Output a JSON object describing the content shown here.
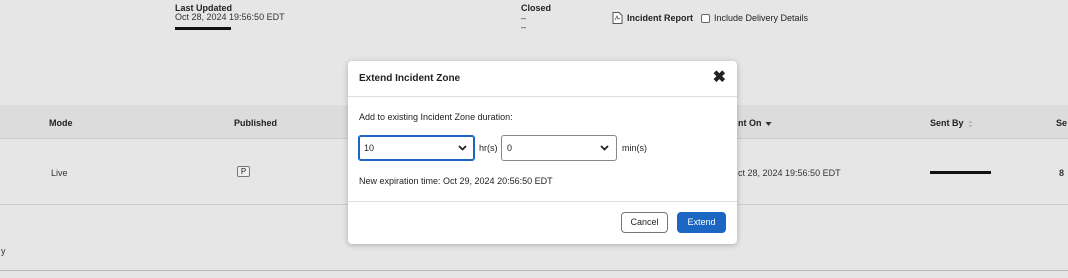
{
  "info": {
    "last_updated_label": "Last Updated",
    "last_updated_value": "Oct 28, 2024 19:56:50 EDT",
    "closed_label": "Closed",
    "closed_value1": "–",
    "closed_value2": "–"
  },
  "report": {
    "label": "Incident Report",
    "include_label": "Include Delivery Details"
  },
  "table": {
    "headers": {
      "mode": "Mode",
      "published": "Published",
      "sent_on": "nt On",
      "sent_by": "Sent By",
      "se": "Se"
    },
    "row": {
      "mode": "Live",
      "published_badge": "P",
      "sent_on": "ct 28, 2024 19:56:50 EDT",
      "se": "8"
    },
    "footer_partial": "y"
  },
  "modal": {
    "title": "Extend Incident Zone",
    "prompt": "Add to existing Incident Zone duration:",
    "hours_value": "10",
    "hours_unit": "hr(s)",
    "minutes_value": "0",
    "minutes_unit": "min(s)",
    "expiration_text": "New expiration time: Oct 29, 2024 20:56:50 EDT",
    "cancel_label": "Cancel",
    "extend_label": "Extend"
  },
  "colors": {
    "accent": "#1a66c2"
  }
}
